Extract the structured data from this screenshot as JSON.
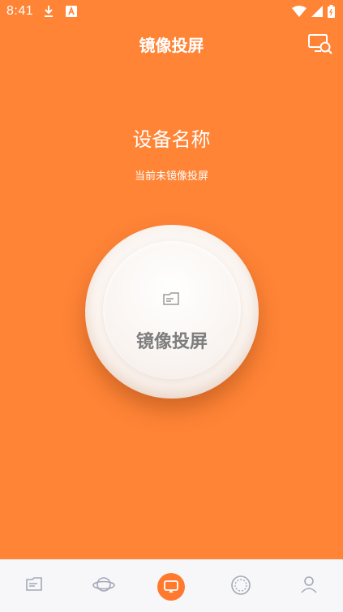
{
  "status_bar": {
    "time": "8:41"
  },
  "header": {
    "title": "镜像投屏"
  },
  "main": {
    "device_name": "设备名称",
    "status_text": "当前未镜像投屏",
    "mirror_button_label": "镜像投屏"
  },
  "icons": {
    "cast_search": "cast-search-icon",
    "document": "document-icon",
    "planet": "planet-icon",
    "cast": "cast-icon",
    "dashed_circle": "dashed-circle-icon",
    "user": "user-icon"
  },
  "colors": {
    "background": "#FF8436",
    "accent": "#FF7A2F",
    "nav_background": "#f7f7f9"
  },
  "bottom_nav": {
    "active_index": 2
  }
}
